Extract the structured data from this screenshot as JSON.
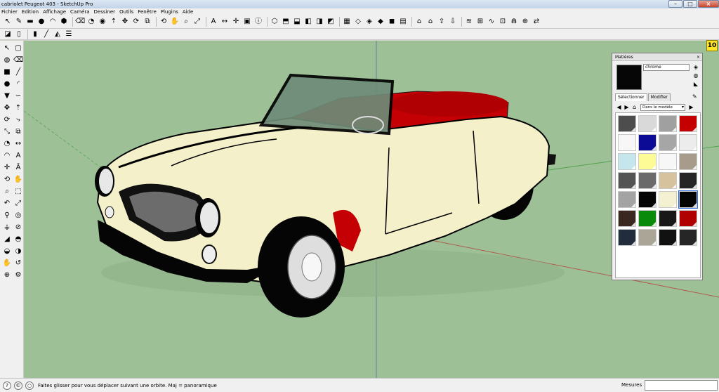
{
  "window": {
    "title": "cabriolet Peugeot 403 - SketchUp Pro"
  },
  "menu": [
    "Fichier",
    "Edition",
    "Affichage",
    "Caméra",
    "Dessiner",
    "Outils",
    "Fenêtre",
    "Plugins",
    "Aide"
  ],
  "toolbar_row1": [
    {
      "icon": "select-arrow-icon",
      "glyph": "↖"
    },
    {
      "icon": "pencil-icon",
      "glyph": "✎"
    },
    {
      "icon": "rectangle-icon",
      "glyph": "▬"
    },
    {
      "icon": "circle-icon",
      "glyph": "●"
    },
    {
      "icon": "arc-icon",
      "glyph": "◠"
    },
    {
      "icon": "polygon-icon",
      "glyph": "⬢"
    },
    {
      "icon": "eraser-icon",
      "glyph": "⌫"
    },
    {
      "icon": "tape-measure-icon",
      "glyph": "◔"
    },
    {
      "icon": "paint-bucket-icon",
      "glyph": "◉"
    },
    {
      "icon": "push-pull-icon",
      "glyph": "⇡"
    },
    {
      "icon": "move-icon",
      "glyph": "✥"
    },
    {
      "icon": "rotate-icon",
      "glyph": "⟳"
    },
    {
      "icon": "offset-icon",
      "glyph": "⧉"
    },
    {
      "icon": "orbit-icon",
      "glyph": "⟲"
    },
    {
      "icon": "pan-icon",
      "glyph": "✋"
    },
    {
      "icon": "zoom-icon",
      "glyph": "⌕"
    },
    {
      "icon": "zoom-extents-icon",
      "glyph": "⤢"
    },
    {
      "icon": "text-icon",
      "glyph": "A"
    },
    {
      "icon": "dimension-icon",
      "glyph": "↔"
    },
    {
      "icon": "axes-icon",
      "glyph": "✛"
    },
    {
      "icon": "component-icon",
      "glyph": "▣"
    },
    {
      "icon": "model-info-icon",
      "glyph": "ⓘ"
    },
    {
      "icon": "iso-view-icon",
      "glyph": "⬡"
    },
    {
      "icon": "top-view-icon",
      "glyph": "⬒"
    },
    {
      "icon": "front-view-icon",
      "glyph": "⬓"
    },
    {
      "icon": "right-view-icon",
      "glyph": "◧"
    },
    {
      "icon": "back-view-icon",
      "glyph": "◨"
    },
    {
      "icon": "left-view-icon",
      "glyph": "◩"
    },
    {
      "icon": "xray-icon",
      "glyph": "▦"
    },
    {
      "icon": "wireframe-icon",
      "glyph": "◇"
    },
    {
      "icon": "hidden-line-icon",
      "glyph": "◈"
    },
    {
      "icon": "shaded-icon",
      "glyph": "◆"
    },
    {
      "icon": "shaded-texture-icon",
      "glyph": "◼"
    },
    {
      "icon": "monochrome-icon",
      "glyph": "▤"
    },
    {
      "icon": "house-icon",
      "glyph": "⌂"
    },
    {
      "icon": "warehouse-icon",
      "glyph": "⌂"
    },
    {
      "icon": "upload-icon",
      "glyph": "⇪"
    },
    {
      "icon": "get-models-icon",
      "glyph": "⇩"
    },
    {
      "icon": "sandbox-contours-icon",
      "glyph": "≋"
    },
    {
      "icon": "sandbox-scratch-icon",
      "glyph": "⊞"
    },
    {
      "icon": "smoove-icon",
      "glyph": "∿"
    },
    {
      "icon": "stamp-icon",
      "glyph": "⊡"
    },
    {
      "icon": "drape-icon",
      "glyph": "⋒"
    },
    {
      "icon": "add-detail-icon",
      "glyph": "⊕"
    },
    {
      "icon": "flip-edge-icon",
      "glyph": "⇄"
    }
  ],
  "toolbar_row2": [
    {
      "icon": "layer-color-icon",
      "glyph": "◪"
    },
    {
      "icon": "section-plane-icon",
      "glyph": "▯"
    },
    {
      "icon": "display-section-icon",
      "glyph": "▮"
    },
    {
      "icon": "section-cut-icon",
      "glyph": "╱"
    },
    {
      "icon": "section-fill-icon",
      "glyph": "◭"
    },
    {
      "icon": "layer-manager-icon",
      "glyph": "☰"
    }
  ],
  "left_tools": [
    {
      "icon": "select-icon",
      "glyph": "↖"
    },
    {
      "icon": "make-component-icon",
      "glyph": "▢"
    },
    {
      "icon": "paint-icon",
      "glyph": "◍"
    },
    {
      "icon": "erase-icon",
      "glyph": "⌫"
    },
    {
      "icon": "rectangle-tool-icon",
      "glyph": "■"
    },
    {
      "icon": "line-tool-icon",
      "glyph": "╱"
    },
    {
      "icon": "circle-tool-icon",
      "glyph": "●"
    },
    {
      "icon": "arc-tool-icon",
      "glyph": "◜"
    },
    {
      "icon": "polygon-tool-icon",
      "glyph": "▼"
    },
    {
      "icon": "freehand-icon",
      "glyph": "∽"
    },
    {
      "icon": "move-tool-icon",
      "glyph": "✥"
    },
    {
      "icon": "pushpull-tool-icon",
      "glyph": "⇡"
    },
    {
      "icon": "rotate-tool-icon",
      "glyph": "⟳"
    },
    {
      "icon": "followme-icon",
      "glyph": "⤷"
    },
    {
      "icon": "scale-tool-icon",
      "glyph": "⤡"
    },
    {
      "icon": "offset-tool-icon",
      "glyph": "⧉"
    },
    {
      "icon": "tape-tool-icon",
      "glyph": "◔"
    },
    {
      "icon": "dimension-tool-icon",
      "glyph": "↔"
    },
    {
      "icon": "protractor-icon",
      "glyph": "◠"
    },
    {
      "icon": "text-tool-icon",
      "glyph": "A"
    },
    {
      "icon": "axes-tool-icon",
      "glyph": "✛"
    },
    {
      "icon": "3dtext-icon",
      "glyph": "Ā"
    },
    {
      "icon": "orbit-tool-icon",
      "glyph": "⟲"
    },
    {
      "icon": "pan-tool-icon",
      "glyph": "✋"
    },
    {
      "icon": "zoom-tool-icon",
      "glyph": "⌕"
    },
    {
      "icon": "zoom-window-icon",
      "glyph": "⬚"
    },
    {
      "icon": "previous-view-icon",
      "glyph": "↶"
    },
    {
      "icon": "zoom-extents-tool-icon",
      "glyph": "⤢"
    },
    {
      "icon": "position-camera-icon",
      "glyph": "⚲"
    },
    {
      "icon": "look-around-icon",
      "glyph": "◎"
    },
    {
      "icon": "walk-icon",
      "glyph": "⚶"
    },
    {
      "icon": "section-tool-icon",
      "glyph": "⊘"
    },
    {
      "icon": "sandbox-icon",
      "glyph": "◢"
    },
    {
      "icon": "smoove-tool-icon",
      "glyph": "◓"
    },
    {
      "icon": "stamp-tool-icon",
      "glyph": "◒"
    },
    {
      "icon": "drape-tool-icon",
      "glyph": "◑"
    },
    {
      "icon": "hand-icon",
      "glyph": "✋"
    },
    {
      "icon": "flip-tool-icon",
      "glyph": "↺"
    },
    {
      "icon": "lock-icon",
      "glyph": "⊕"
    },
    {
      "icon": "gear-icon",
      "glyph": "⚙"
    }
  ],
  "materials": {
    "title": "Matières",
    "close": "×",
    "current_name": "chrome",
    "current_color": "#060606",
    "tab_select": "Sélectionner",
    "tab_edit": "Modifier",
    "collection": "Dans le modèle",
    "swatches": [
      "#4d4d4d",
      "#d9d9d9",
      "#a0a0a0",
      "#c40000",
      "#f7f7f7",
      "#0b0b96",
      "#a6a6a6",
      "#ececec",
      "#c5e6ec",
      "#fdfb96",
      "#f7f7f7",
      "#a79c8c",
      "#545454",
      "#6a6a6a",
      "#d6c29c",
      "#262626",
      "#a3a3a3",
      "#050505",
      "#f4f0d2",
      "#040404",
      "#3a2720",
      "#0a8a0a",
      "#181818",
      "#b00000",
      "#212c3c",
      "#aaa597",
      "#111111",
      "#262626"
    ],
    "selected_swatch": 19
  },
  "vcb_badge": "10",
  "status": {
    "hint": "Faites glisser pour vous déplacer suivant une orbite.  Maj = panoramique",
    "measure_label": "Mesures",
    "measure_value": ""
  }
}
